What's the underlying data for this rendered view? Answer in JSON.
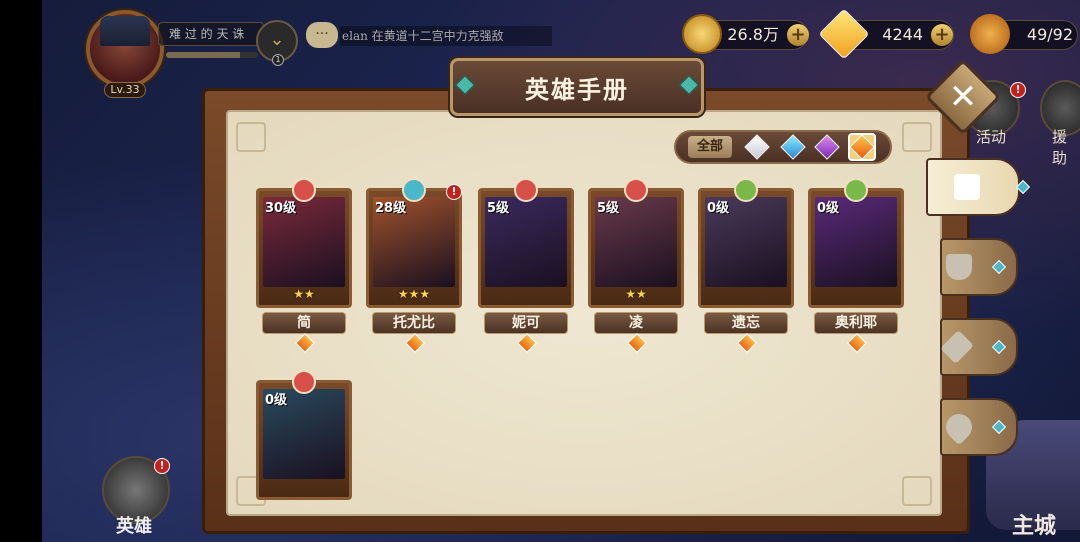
{
  "player": {
    "level_label": "Lv.33",
    "quest_title": "难 过 的 天 诛",
    "quest_progress": 0.8,
    "quest_notification_count": "1",
    "chat_message": "elan 在黄道十二宫中力克强敌"
  },
  "currencies": {
    "gold": "26.8万",
    "diamonds": "4244",
    "stamina": "49/92"
  },
  "right_rail": {
    "activity_label": "活动",
    "assist_label": "援助",
    "activity_badge": "!"
  },
  "bottom_nav": {
    "hero_label": "英雄",
    "hero_badge": "!",
    "city_label": "主城"
  },
  "panel": {
    "title": "英雄手册",
    "filter_all_label": "全部",
    "filters": [
      "white-gem-icon",
      "blue-gem-icon",
      "purple-gem-icon",
      "orange-gem-icon"
    ],
    "selected_filter": "orange-gem-icon",
    "side_tabs": [
      "all-tab",
      "defense-tab",
      "attack-tab",
      "support-tab"
    ],
    "active_side_tab": "all-tab"
  },
  "heroes": [
    {
      "name": "简",
      "level": "30级",
      "stars": "★★",
      "art_color": "#7a2a3a",
      "badge_type": "sword",
      "badge_color": "#d8504a",
      "alert": ""
    },
    {
      "name": "托尤比",
      "level": "28级",
      "stars": "★★★",
      "art_color": "#a0522d",
      "badge_type": "diamond",
      "badge_color": "#4ab8c8",
      "alert": "!"
    },
    {
      "name": "妮可",
      "level": "5级",
      "stars": "",
      "art_color": "#3a2a5e",
      "badge_type": "sword",
      "badge_color": "#d8504a",
      "alert": ""
    },
    {
      "name": "凌",
      "level": "5级",
      "stars": "★★",
      "art_color": "#6a3a4a",
      "badge_type": "sword",
      "badge_color": "#d8504a",
      "alert": ""
    },
    {
      "name": "遗忘",
      "level": "0级",
      "stars": "",
      "art_color": "#4a3a5a",
      "badge_type": "leaf",
      "badge_color": "#7ab84a",
      "alert": ""
    },
    {
      "name": "奥利耶",
      "level": "0级",
      "stars": "",
      "art_color": "#5a2a7a",
      "badge_type": "leaf",
      "badge_color": "#7ab84a",
      "alert": ""
    },
    {
      "name": "",
      "level": "0级",
      "stars": "",
      "art_color": "#2a4a5e",
      "badge_type": "sword",
      "badge_color": "#d8504a",
      "alert": ""
    }
  ]
}
